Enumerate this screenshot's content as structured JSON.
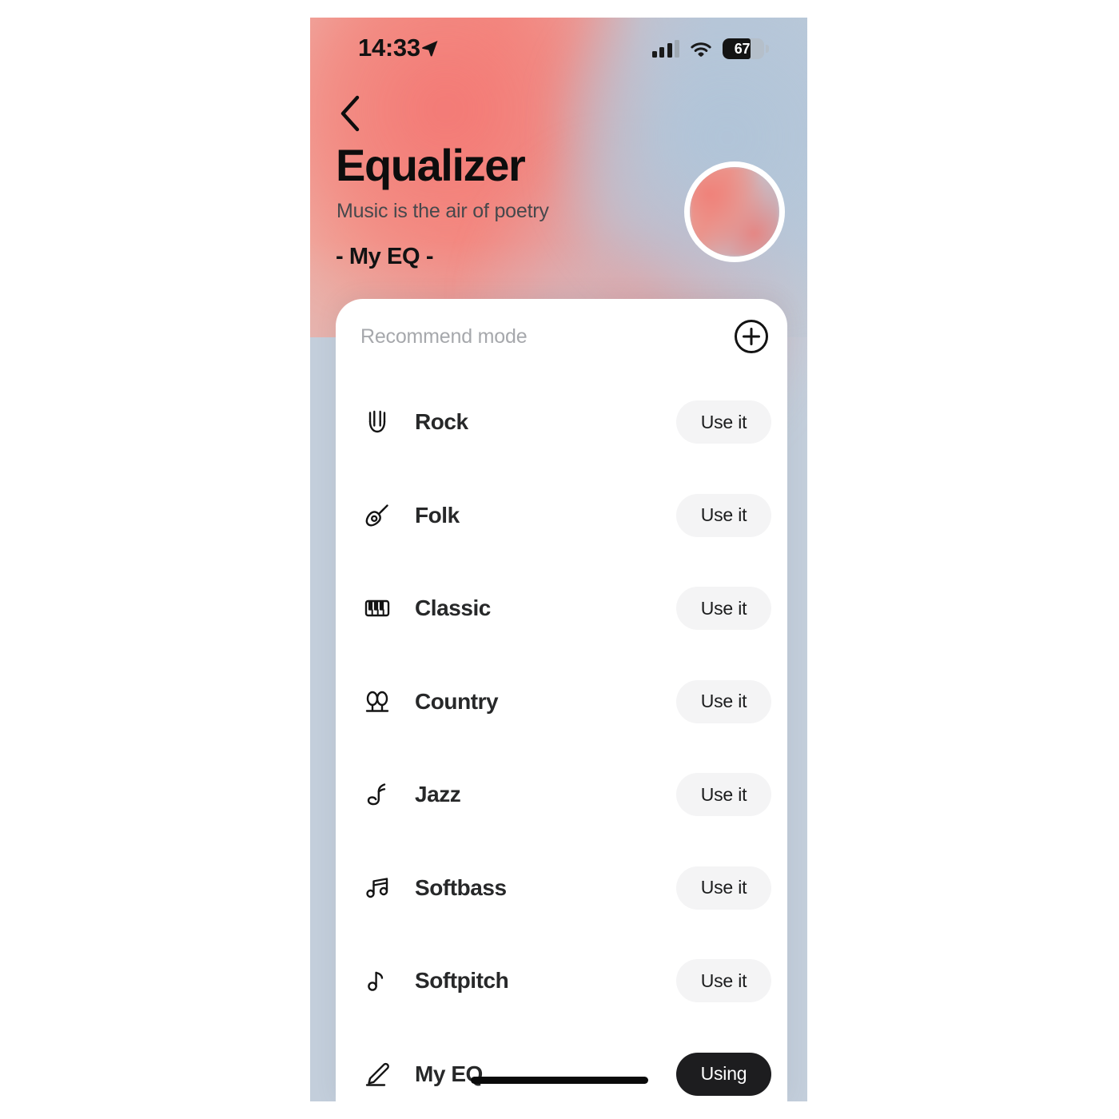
{
  "statusbar": {
    "time": "14:33",
    "location_icon": "location-arrow-icon",
    "signal_icon": "cellular-signal-icon",
    "wifi_icon": "wifi-icon",
    "battery_percent": "67",
    "battery_level": 67
  },
  "header": {
    "back_icon": "chevron-left-icon",
    "title": "Equalizer",
    "subtitle": "Music is the air of poetry",
    "current_eq": "- My EQ -",
    "avatar_icon": "avatar"
  },
  "card": {
    "section_label": "Recommend mode",
    "add_icon": "plus-circle-icon"
  },
  "presets": [
    {
      "name": "Rock",
      "icon": "rock-hand-icon",
      "action": "Use it",
      "active": false
    },
    {
      "name": "Folk",
      "icon": "guitar-icon",
      "action": "Use it",
      "active": false
    },
    {
      "name": "Classic",
      "icon": "piano-icon",
      "action": "Use it",
      "active": false
    },
    {
      "name": "Country",
      "icon": "trees-icon",
      "action": "Use it",
      "active": false
    },
    {
      "name": "Jazz",
      "icon": "saxophone-icon",
      "action": "Use it",
      "active": false
    },
    {
      "name": "Softbass",
      "icon": "double-note-icon",
      "action": "Use it",
      "active": false
    },
    {
      "name": "Softpitch",
      "icon": "single-note-icon",
      "action": "Use it",
      "active": false
    },
    {
      "name": "My EQ",
      "icon": "pencil-edit-icon",
      "action": "Using",
      "active": true
    }
  ],
  "colors": {
    "accent_warm": "#f3938c",
    "accent_cool": "#b9c6d6",
    "active_button": "#1d1d1f",
    "idle_button": "#f4f4f5",
    "card_bg": "#ffffff",
    "text_primary": "#272829",
    "text_muted": "#a6a8ac"
  },
  "home_indicator": "home-indicator"
}
